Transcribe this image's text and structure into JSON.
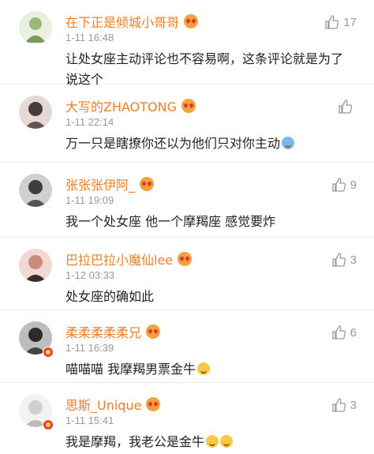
{
  "comments": [
    {
      "name": "在下正是倾城小哥哥",
      "time": "1-11 16:48",
      "likes": "17",
      "text": "让处女座主动评论也不容易啊，这条评论就是为了说这个",
      "avatar_color": "#9bb77a"
    },
    {
      "name": "大写的ZHAOTONG",
      "time": "1-11 22:14",
      "likes": "",
      "text": "万一只是瞎撩你还以为他们只对你主动",
      "avatar_color": "#4a3b3b"
    },
    {
      "name": "张张张伊阿_",
      "time": "1-11 19:09",
      "likes": "9",
      "text": "我一个处女座 他一个摩羯座 感觉要炸",
      "avatar_color": "#3d3d3d"
    },
    {
      "name": "巴拉巴拉小魔仙lee",
      "time": "1-12 03:33",
      "likes": "3",
      "text": "处女座的确如此",
      "avatar_color": "#c98b7a"
    },
    {
      "name": "柔柔柔柔柔兄",
      "time": "1-11 16:39",
      "likes": "6",
      "text": "喵喵喵 我摩羯男票金牛",
      "avatar_color": "#2d2a28"
    },
    {
      "name": "思斯_Unique",
      "time": "1-11 15:41",
      "likes": "3",
      "text": "我是摩羯，我老公是金牛",
      "avatar_color": "#d8d8d8"
    }
  ],
  "colors": {
    "name": "#e8802c",
    "time": "#999999",
    "text": "#222222",
    "divider": "#ececec"
  },
  "icons": {
    "like": "thumbs-up-icon",
    "name_badge": "heart-eyes-emoji-icon",
    "vip": "vip-badge-icon"
  }
}
